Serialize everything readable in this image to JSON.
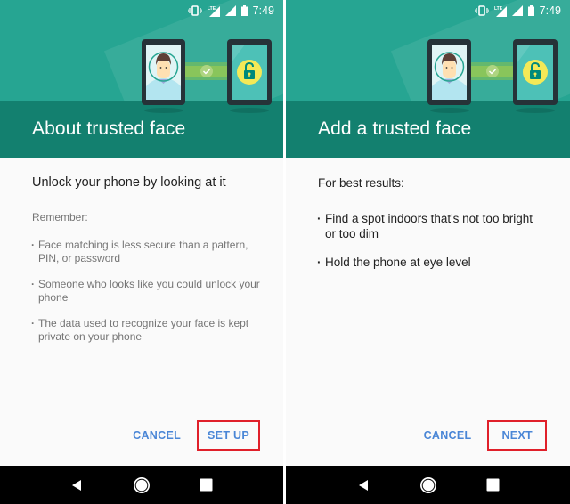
{
  "status_bar": {
    "time": "7:49",
    "icons": [
      "vibrate-icon",
      "lte-signal-icon",
      "signal-icon",
      "battery-icon"
    ]
  },
  "screens": [
    {
      "title": "About trusted face",
      "lead": "Unlock your phone by looking at it",
      "subheading": "Remember:",
      "bullets": [
        "Face matching is less secure than a pattern, PIN, or password",
        "Someone who looks like you could unlock your phone",
        "The data used to recognize your face is kept private on your phone"
      ],
      "cancel_label": "CANCEL",
      "primary_label": "SET UP"
    },
    {
      "title": "Add a trusted face",
      "lead": "For best results:",
      "bullets": [
        "Find a spot indoors that's not too bright or too dim",
        "Hold the phone at eye level"
      ],
      "cancel_label": "CANCEL",
      "primary_label": "NEXT"
    }
  ],
  "navbar": {
    "back": "back-icon",
    "home": "home-icon",
    "recents": "recents-icon"
  },
  "colors": {
    "header_teal": "#26a592",
    "header_band": "#13806f",
    "accent_button": "#4a86d6",
    "highlight_box": "#e0202a"
  }
}
